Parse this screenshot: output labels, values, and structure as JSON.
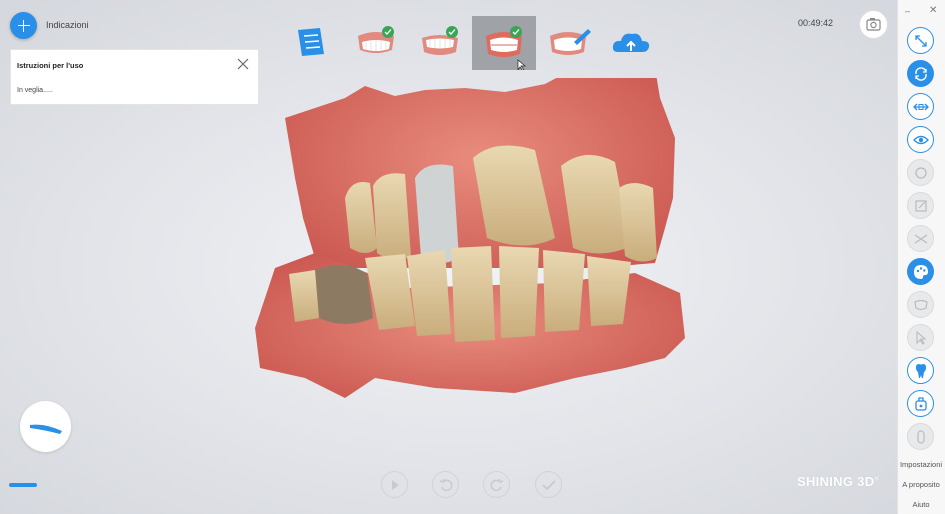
{
  "header": {
    "add_label": "Indicazioni",
    "timer": "00:49:42"
  },
  "instructions": {
    "title": "Istruzioni per l'uso",
    "status": "In veglia....."
  },
  "steps": [
    {
      "name": "notes",
      "icon": "document-icon",
      "checked": false,
      "active": false
    },
    {
      "name": "upper-jaw",
      "icon": "upper-jaw-icon",
      "checked": true,
      "active": false
    },
    {
      "name": "lower-jaw",
      "icon": "lower-jaw-icon",
      "checked": true,
      "active": false
    },
    {
      "name": "bite",
      "icon": "bite-icon",
      "checked": true,
      "active": true
    },
    {
      "name": "edit",
      "icon": "edit-teeth-icon",
      "checked": false,
      "active": false
    },
    {
      "name": "upload",
      "icon": "cloud-upload-icon",
      "checked": false,
      "active": false
    }
  ],
  "right_toolbar": {
    "menu": [
      "Impostazioni",
      "A proposito",
      "Aiuto"
    ]
  },
  "brand": "SHINING 3D",
  "brand_mark": "®",
  "colors": {
    "accent": "#2a8fe6",
    "check": "#3aa655",
    "active_step": "#9fa3a8"
  }
}
